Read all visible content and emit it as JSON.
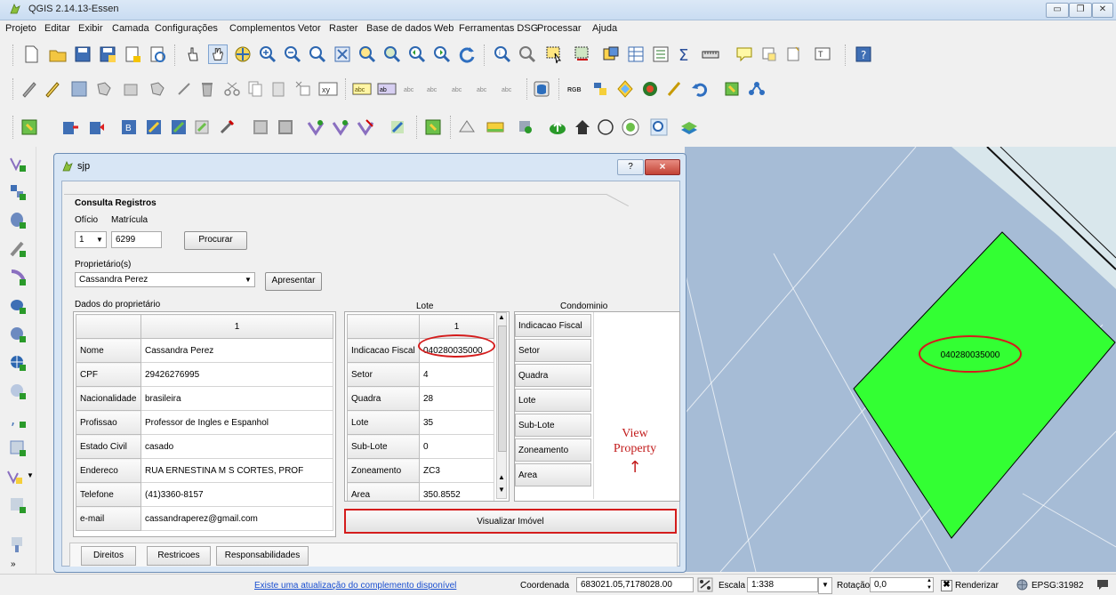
{
  "window": {
    "title": "QGIS 2.14.13-Essen",
    "controls": [
      "minimize",
      "maximize",
      "close"
    ]
  },
  "menu": [
    "Projeto",
    "Editar",
    "Exibir",
    "Camada",
    "Configurações",
    "Complementos",
    "Vetor",
    "Raster",
    "Base de dados",
    "Web",
    "Ferramentas DSG",
    "Processar",
    "Ajuda"
  ],
  "toolbar1": [
    "new-project-icon",
    "open-project-icon",
    "save-project-icon",
    "save-as-icon",
    "new-print-composer-icon",
    "composer-manager-icon",
    "touch-zoom-icon",
    "pan-icon",
    "pan-to-selection-icon",
    "zoom-in-icon",
    "zoom-out-icon",
    "zoom-native-icon",
    "zoom-full-icon",
    "zoom-to-selection-icon",
    "zoom-to-layer-icon",
    "zoom-last-icon",
    "zoom-next-icon",
    "refresh-icon",
    "identify-icon",
    "select-icon",
    "deselect-icon",
    "open-attribute-table-icon",
    "statistics-icon",
    "measure-icon",
    "annotation-icon",
    "map-tips-icon",
    "new-bookmark-icon",
    "bookmarks-icon",
    "text-annotation-icon",
    "help-icon"
  ],
  "dialog": {
    "title": "sjp",
    "help_label": "?",
    "close_label": "×",
    "section_title": "Consulta Registros",
    "oficio_label": "Ofício",
    "matricula_label": "Matrícula",
    "oficio_value": "1",
    "matricula_value": "6299",
    "search_button": "Procurar",
    "proprietarios_label": "Proprietário(s)",
    "proprietario_selected": "Cassandra Perez",
    "show_button": "Apresentar",
    "owner_data_label": "Dados do proprietário",
    "lote_label": "Lote",
    "condominio_label": "Condominio",
    "owner_table": {
      "column_header": "1",
      "rows": [
        {
          "field": "Nome",
          "value": "Cassandra Perez"
        },
        {
          "field": "CPF",
          "value": "29426276995"
        },
        {
          "field": "Nacionalidade",
          "value": "brasileira"
        },
        {
          "field": "Profissao",
          "value": "Professor de Ingles e Espanhol"
        },
        {
          "field": "Estado Civil",
          "value": "casado"
        },
        {
          "field": "Endereco",
          "value": "RUA   ERNESTINA M S CORTES, PROF"
        },
        {
          "field": "Telefone",
          "value": "(41)3360-8157"
        },
        {
          "field": "e-mail",
          "value": "cassandraperez@gmail.com"
        }
      ]
    },
    "lote_table": {
      "column_header": "1",
      "rows": [
        {
          "field": "Indicacao Fiscal",
          "value": "040280035000"
        },
        {
          "field": "Setor",
          "value": "4"
        },
        {
          "field": "Quadra",
          "value": "28"
        },
        {
          "field": "Lote",
          "value": "35"
        },
        {
          "field": "Sub-Lote",
          "value": "0"
        },
        {
          "field": "Zoneamento",
          "value": "ZC3"
        },
        {
          "field": "Area",
          "value": "350.8552"
        }
      ]
    },
    "condominio_buttons": [
      "Indicacao Fiscal",
      "Setor",
      "Quadra",
      "Lote",
      "Sub-Lote",
      "Zoneamento",
      "Area"
    ],
    "annotation": "View\nProperty",
    "annotation_arrow": "↑",
    "view_property_button": "Visualizar Imóvel",
    "tabs": [
      "Direitos",
      "Restricoes",
      "Responsabilidades"
    ]
  },
  "map": {
    "parcel_label": "040280035000",
    "parcel_color": "#33ff33",
    "background_color": "#a6bcd6",
    "highlight_color": "#d41c1c"
  },
  "statusbar": {
    "plugin_update_link": "Existe uma atualização do complemento disponível",
    "coord_label": "Coordenada",
    "coord_value": "683021.05,7178028.00",
    "scale_label": "Escala",
    "scale_value": "1:338",
    "rotation_label": "Rotação",
    "rotation_value": "0,0",
    "render_label": "Renderizar",
    "crs_label": "EPSG:31982"
  }
}
